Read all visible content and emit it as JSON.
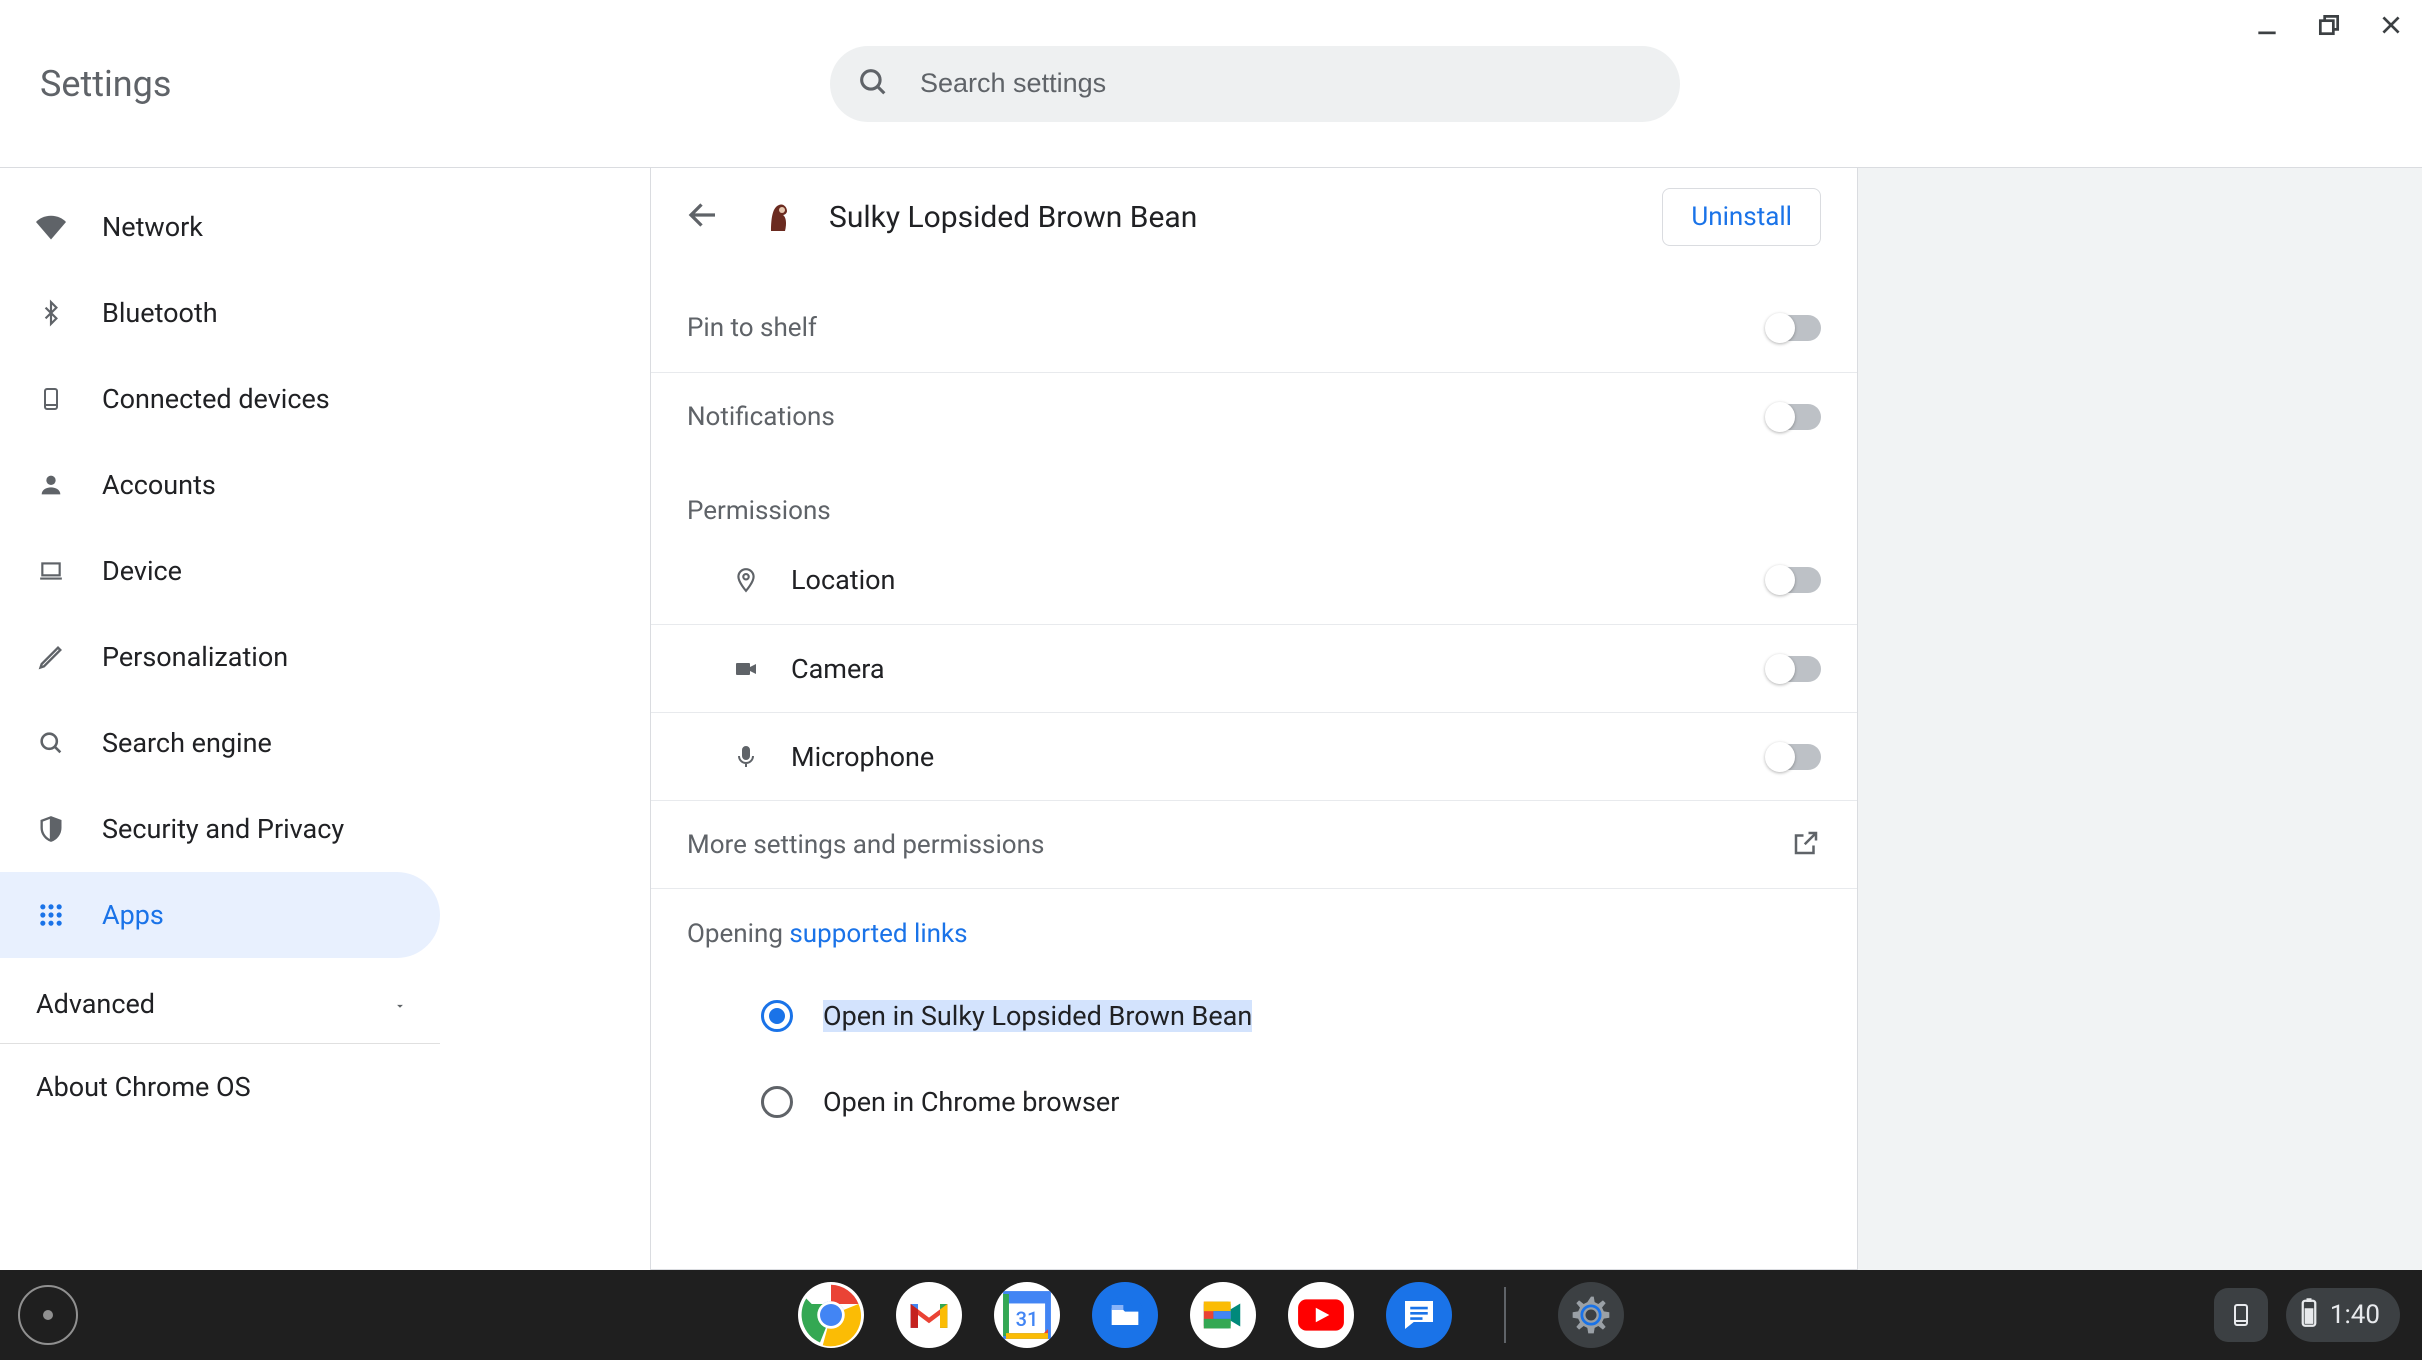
{
  "window": {
    "title": "Settings"
  },
  "search": {
    "placeholder": "Search settings"
  },
  "sidebar": {
    "items": [
      {
        "label": "Network"
      },
      {
        "label": "Bluetooth"
      },
      {
        "label": "Connected devices"
      },
      {
        "label": "Accounts"
      },
      {
        "label": "Device"
      },
      {
        "label": "Personalization"
      },
      {
        "label": "Search engine"
      },
      {
        "label": "Security and Privacy"
      },
      {
        "label": "Apps"
      }
    ],
    "advanced_label": "Advanced",
    "about_label": "About Chrome OS"
  },
  "app_detail": {
    "name": "Sulky Lopsided Brown Bean",
    "uninstall_label": "Uninstall",
    "pin_label": "Pin to shelf",
    "pin_value": false,
    "notifications_label": "Notifications",
    "notifications_value": false,
    "permissions_heading": "Permissions",
    "permissions": [
      {
        "label": "Location",
        "value": false
      },
      {
        "label": "Camera",
        "value": false
      },
      {
        "label": "Microphone",
        "value": false
      }
    ],
    "more_label": "More settings and permissions",
    "opening_prefix": "Opening ",
    "supported_links_text": "supported links",
    "radio_options": [
      {
        "label": "Open in Sulky Lopsided Brown Bean",
        "selected": true
      },
      {
        "label": "Open in Chrome browser",
        "selected": false
      }
    ]
  },
  "shelf": {
    "apps": [
      {
        "name": "chrome"
      },
      {
        "name": "gmail"
      },
      {
        "name": "calendar",
        "badge": "31"
      },
      {
        "name": "files"
      },
      {
        "name": "meet"
      },
      {
        "name": "youtube"
      },
      {
        "name": "messages"
      },
      {
        "name": "settings",
        "active": true
      }
    ],
    "clock": "1:40"
  }
}
